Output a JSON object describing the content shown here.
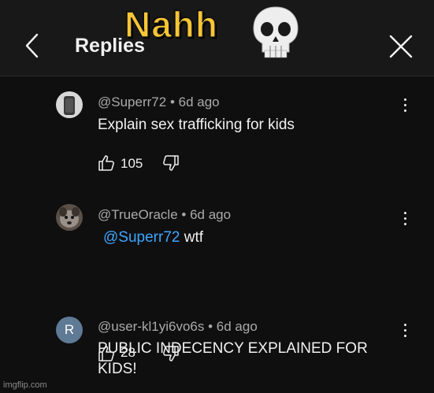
{
  "header": {
    "title": "Replies",
    "meme_caption": "Nahh"
  },
  "comments": [
    {
      "handle": "@Superr72",
      "age": "6d ago",
      "text": "Explain sex trafficking for kids",
      "likes": "105",
      "avatar_letter": ""
    },
    {
      "handle": "@TrueOracle",
      "age": "6d ago",
      "mention": "@Superr72",
      "text": "wtf",
      "likes": "28",
      "avatar_letter": ""
    },
    {
      "handle": "@user-kl1yi6vo6s",
      "age": "6d ago",
      "text_line1": "PUBLIC INDECENCY EXPLAINED FOR",
      "text_line2": "KIDS!",
      "avatar_letter": "R"
    }
  ],
  "watermark": "imgflip.com",
  "colors": {
    "background": "#0f0f0f",
    "mention": "#3ea6ff",
    "caption": "#f8c534",
    "avatar_r": "#5f7a94"
  },
  "icons": [
    "back-arrow-icon",
    "close-icon",
    "skull-icon",
    "more-vert-icon",
    "thumbs-up-icon",
    "thumbs-down-icon"
  ]
}
